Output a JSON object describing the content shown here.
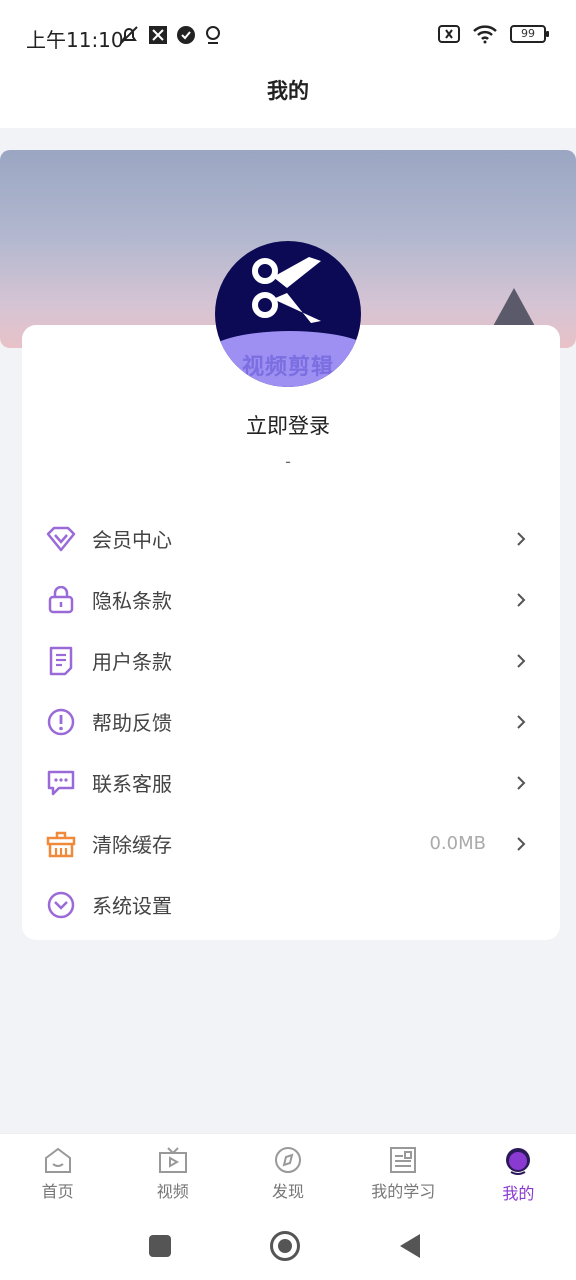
{
  "status": {
    "time": "上午11:10",
    "battery": "99"
  },
  "header": {
    "title": "我的"
  },
  "profile": {
    "login_text": "立即登录",
    "sub_text": "-",
    "logo_text": "视频剪辑"
  },
  "menu": [
    {
      "label": "会员中心",
      "icon": "diamond-icon",
      "value": ""
    },
    {
      "label": "隐私条款",
      "icon": "lock-icon",
      "value": ""
    },
    {
      "label": "用户条款",
      "icon": "document-icon",
      "value": ""
    },
    {
      "label": "帮助反馈",
      "icon": "exclamation-icon",
      "value": ""
    },
    {
      "label": "联系客服",
      "icon": "chat-icon",
      "value": ""
    },
    {
      "label": "清除缓存",
      "icon": "basket-icon",
      "value": "0.0MB"
    },
    {
      "label": "系统设置",
      "icon": "chevron-circle-icon",
      "value": ""
    }
  ],
  "tabs": [
    {
      "label": "首页",
      "icon": "home-icon"
    },
    {
      "label": "视频",
      "icon": "tv-icon"
    },
    {
      "label": "发现",
      "icon": "compass-icon"
    },
    {
      "label": "我的学习",
      "icon": "study-icon"
    },
    {
      "label": "我的",
      "icon": "profile-icon"
    }
  ],
  "colors": {
    "accent": "#8a3ad0",
    "icon_purple": "#9a6ad8",
    "icon_orange": "#f08a3a"
  }
}
